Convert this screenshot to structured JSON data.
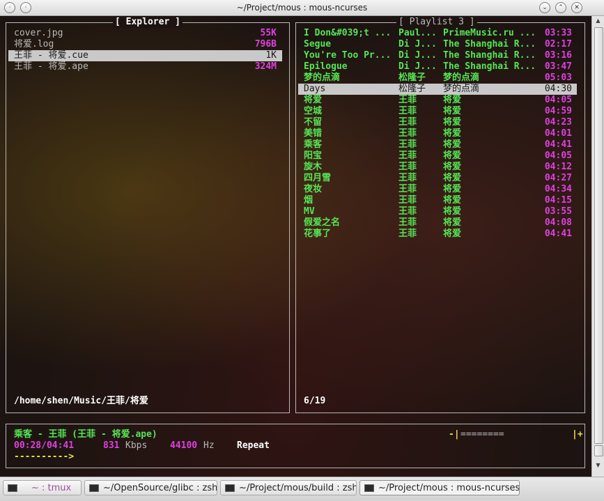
{
  "window": {
    "title": "~/Project/mous : mous-ncurses",
    "btn_min": "⌄",
    "btn_max": "⌃",
    "btn_close": "✕",
    "btn_menu": "·"
  },
  "explorer": {
    "title": "[ Explorer ]",
    "items": [
      {
        "name": "cover.jpg",
        "size": "55K"
      },
      {
        "name": "将爱.log",
        "size": "796B"
      },
      {
        "name": "王菲 - 将爱.cue",
        "size": "1K"
      },
      {
        "name": "王菲 - 将爱.ape",
        "size": "324M"
      }
    ],
    "path": "/home/shen/Music/王菲/将爱"
  },
  "playlist": {
    "title": "[ Playlist 3 ]",
    "items": [
      {
        "title": "I Don&#039;t ...",
        "artist": "Paul...",
        "album": "PrimeMusic.ru ...",
        "duration": "03:33"
      },
      {
        "title": "Segue",
        "artist": "Di J...",
        "album": "The Shanghai R...",
        "duration": "02:17"
      },
      {
        "title": "You're Too Pr...",
        "artist": "Di J...",
        "album": "The Shanghai R...",
        "duration": "03:16"
      },
      {
        "title": "Epilogue",
        "artist": "Di J...",
        "album": "The Shanghai R...",
        "duration": "03:47"
      },
      {
        "title": "梦的点滴",
        "artist": "松隆子",
        "album": "梦的点滴",
        "duration": "05:03"
      },
      {
        "title": "Days",
        "artist": "松隆子",
        "album": "梦的点滴",
        "duration": "04:30"
      },
      {
        "title": "将爱",
        "artist": "王菲",
        "album": "将爱",
        "duration": "04:05"
      },
      {
        "title": "空城",
        "artist": "王菲",
        "album": "将爱",
        "duration": "04:59"
      },
      {
        "title": "不留",
        "artist": "王菲",
        "album": "将爱",
        "duration": "04:23"
      },
      {
        "title": "美错",
        "artist": "王菲",
        "album": "将爱",
        "duration": "04:01"
      },
      {
        "title": "乘客",
        "artist": "王菲",
        "album": "将爱",
        "duration": "04:41"
      },
      {
        "title": "阳宝",
        "artist": "王菲",
        "album": "将爱",
        "duration": "04:05"
      },
      {
        "title": "旋木",
        "artist": "王菲",
        "album": "将爱",
        "duration": "04:12"
      },
      {
        "title": "四月雪",
        "artist": "王菲",
        "album": "将爱",
        "duration": "04:27"
      },
      {
        "title": "夜妆",
        "artist": "王菲",
        "album": "将爱",
        "duration": "04:34"
      },
      {
        "title": "烟",
        "artist": "王菲",
        "album": "将爱",
        "duration": "04:15"
      },
      {
        "title": "MV",
        "artist": "王菲",
        "album": "将爱",
        "duration": "03:55"
      },
      {
        "title": "假爱之名",
        "artist": "王菲",
        "album": "将爱",
        "duration": "04:08"
      },
      {
        "title": "花事了",
        "artist": "王菲",
        "album": "将爱",
        "duration": "04:41"
      }
    ],
    "position": "6/19"
  },
  "status": {
    "now_playing": "乘客 - 王菲 (王菲 - 将爱.ape)",
    "time": "00:28/04:41",
    "bitrate": "831",
    "bitrate_unit": "Kbps",
    "samplerate": "44100",
    "samplerate_unit": "Hz",
    "mode": "Repeat",
    "volume_left": "-|",
    "volume_bar": "========",
    "volume_right": "|+",
    "progress": "---------->",
    "progress_fraction": 0.1
  },
  "taskbar": {
    "tasks": [
      {
        "label": "~ : tmux"
      },
      {
        "label": "~/OpenSource/glibc : zsh"
      },
      {
        "label": "~/Project/mous/build : zsh"
      },
      {
        "label": "~/Project/mous : mous-ncurses"
      }
    ]
  },
  "scrollbar": {
    "up_arrow": "▲",
    "down_arrow": "▼"
  }
}
